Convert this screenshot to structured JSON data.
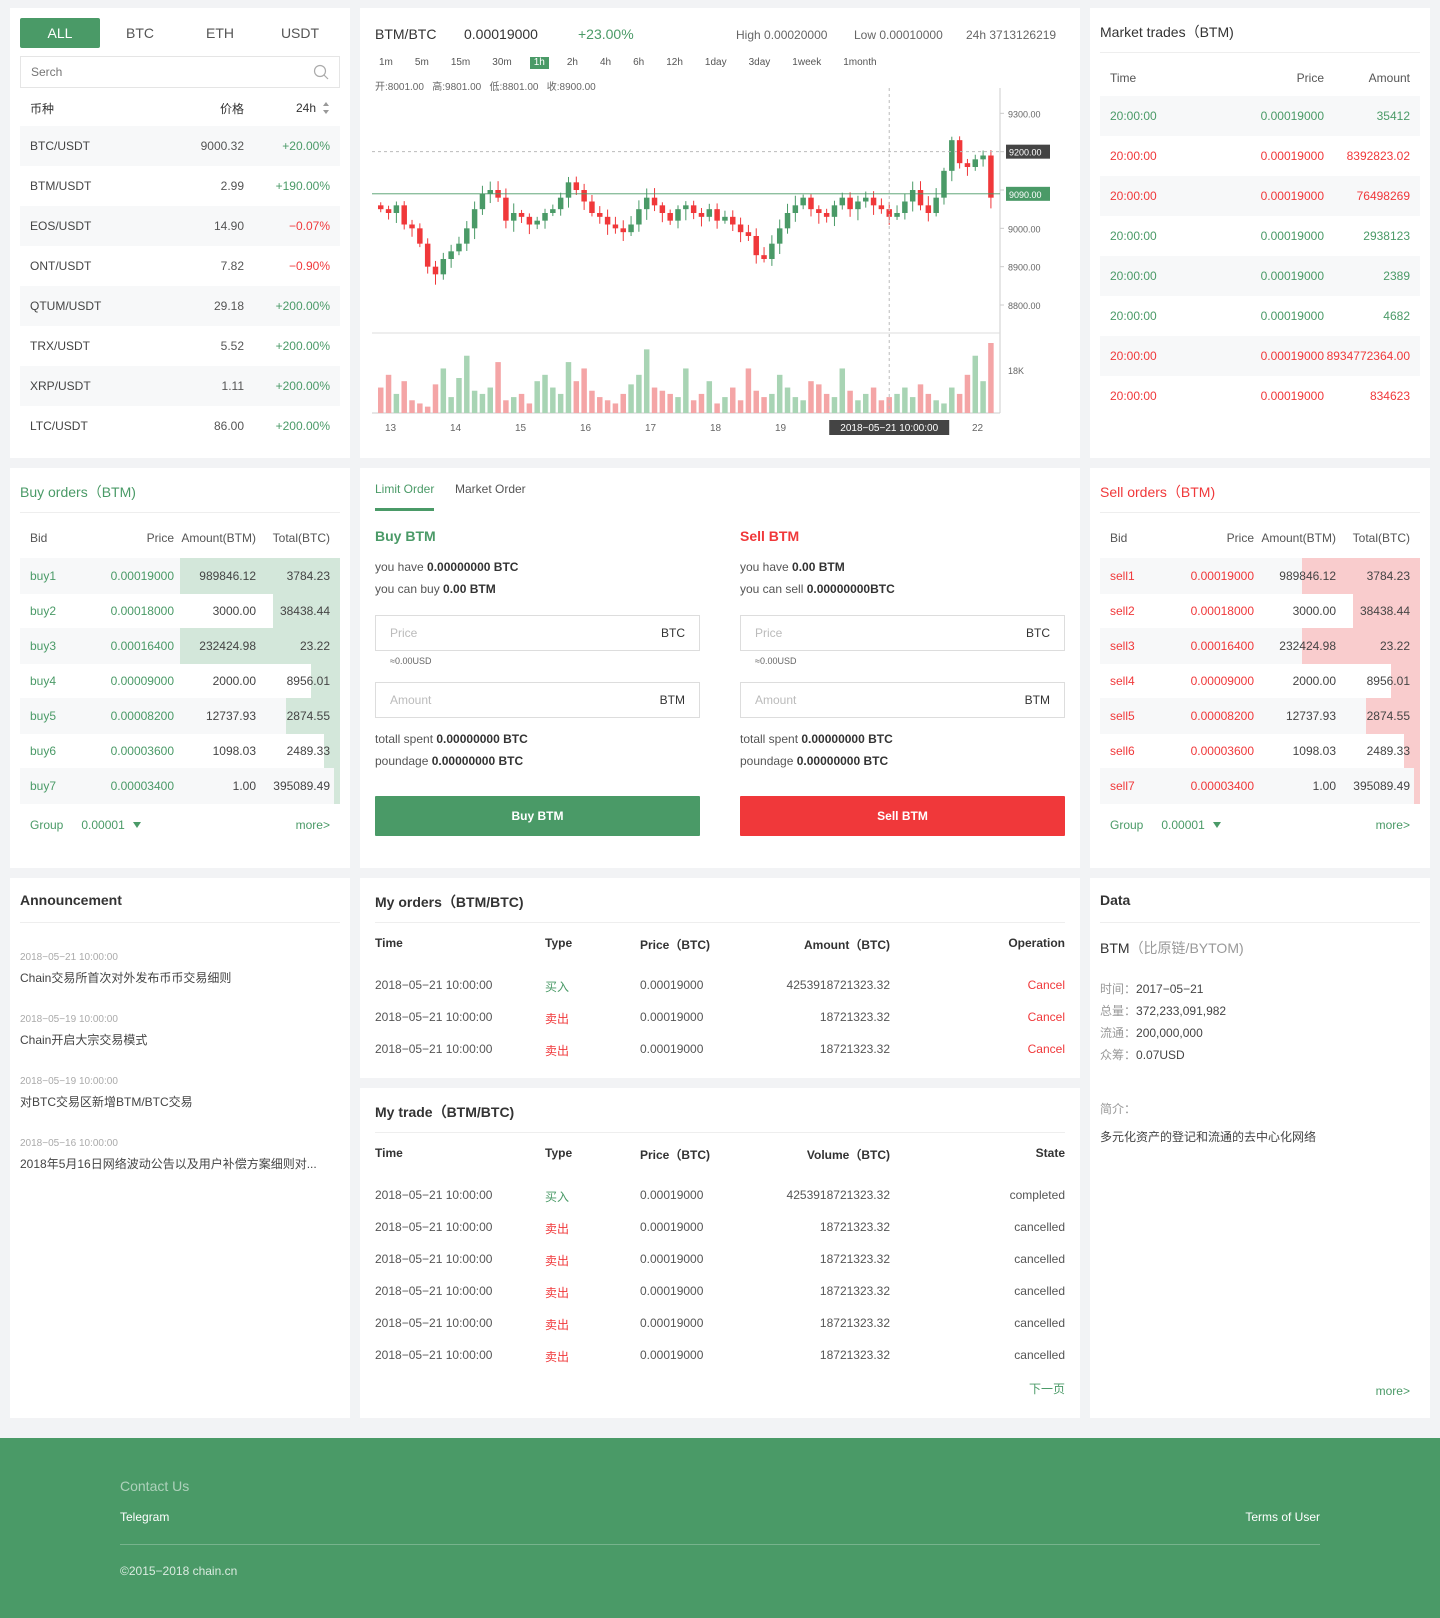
{
  "market": {
    "tabs": [
      "ALL",
      "BTC",
      "ETH",
      "USDT"
    ],
    "search_placeholder": "Serch",
    "headers": {
      "coin": "币种",
      "price": "价格",
      "change": "24h"
    },
    "rows": [
      {
        "pair": "BTC/USDT",
        "price": "9000.32",
        "change": "+20.00%",
        "dir": "up"
      },
      {
        "pair": "BTM/USDT",
        "price": "2.99",
        "change": "+190.00%",
        "dir": "up"
      },
      {
        "pair": "EOS/USDT",
        "price": "14.90",
        "change": "−0.07%",
        "dir": "down"
      },
      {
        "pair": "ONT/USDT",
        "price": "7.82",
        "change": "−0.90%",
        "dir": "down"
      },
      {
        "pair": "QTUM/USDT",
        "price": "29.18",
        "change": "+200.00%",
        "dir": "up"
      },
      {
        "pair": "TRX/USDT",
        "price": "5.52",
        "change": "+200.00%",
        "dir": "up"
      },
      {
        "pair": "XRP/USDT",
        "price": "1.11",
        "change": "+200.00%",
        "dir": "up"
      },
      {
        "pair": "LTC/USDT",
        "price": "86.00",
        "change": "+200.00%",
        "dir": "up"
      }
    ]
  },
  "chart": {
    "pair": "BTM/BTC",
    "price": "0.00019000",
    "change": "+23.00%",
    "high": "High 0.00020000",
    "low": "Low 0.00010000",
    "vol24": "24h 3713126219",
    "timeframes": [
      "1m",
      "5m",
      "15m",
      "30m",
      "1h",
      "2h",
      "4h",
      "6h",
      "12h",
      "1day",
      "3day",
      "1week",
      "1month"
    ],
    "active_tf": "1h",
    "ohlc": "开:8001.00   高:9801.00   低:8801.00   收:8900.00",
    "y_ticks": [
      "9300.00",
      "9200.00",
      "9100.00",
      "9000.00",
      "8900.00",
      "8800.00"
    ],
    "vol_tick": "18K",
    "x_ticks": [
      "13",
      "14",
      "15",
      "16",
      "17",
      "18",
      "19",
      "22"
    ],
    "cursor_time": "2018−05−21 10:00:00",
    "tag_a": "9200.00",
    "tag_b": "9090.00"
  },
  "chart_data": {
    "type": "candlestick",
    "x_ticks": [
      "13",
      "14",
      "15",
      "16",
      "17",
      "18",
      "19",
      "22"
    ],
    "ylim": [
      8740,
      9340
    ],
    "closes": [
      9050,
      9040,
      9060,
      9010,
      9000,
      8960,
      8900,
      8880,
      8920,
      8940,
      8960,
      9000,
      9050,
      9090,
      9100,
      9080,
      9020,
      9040,
      9030,
      9010,
      9020,
      9040,
      9050,
      9080,
      9120,
      9100,
      9070,
      9040,
      9030,
      9010,
      9000,
      8990,
      9010,
      9050,
      9080,
      9060,
      9040,
      9020,
      9050,
      9060,
      9040,
      9030,
      9050,
      9020,
      9030,
      9010,
      8990,
      8980,
      8930,
      8920,
      8960,
      9000,
      9040,
      9060,
      9080,
      9050,
      9040,
      9030,
      9060,
      9080,
      9050,
      9070,
      9080,
      9060,
      9050,
      9030,
      9040,
      9070,
      9100,
      9060,
      9040,
      9080,
      9150,
      9230,
      9170,
      9160,
      9180,
      9190,
      9080
    ],
    "volumes": [
      8,
      12,
      6,
      10,
      4,
      3,
      2,
      9,
      14,
      5,
      11,
      18,
      7,
      6,
      8,
      16,
      4,
      5,
      6,
      3,
      10,
      12,
      8,
      6,
      16,
      10,
      14,
      7,
      5,
      4,
      3,
      6,
      9,
      12,
      20,
      8,
      7,
      6,
      5,
      14,
      4,
      6,
      10,
      3,
      5,
      8,
      4,
      14,
      7,
      5,
      6,
      12,
      8,
      5,
      4,
      10,
      9,
      6,
      5,
      14,
      7,
      4,
      6,
      8,
      4,
      5,
      6,
      8,
      5,
      9,
      6,
      4,
      3,
      8,
      6,
      12,
      18,
      10,
      22
    ]
  },
  "trades": {
    "title": "Market trades（BTM)",
    "headers": {
      "time": "Time",
      "price": "Price",
      "amount": "Amount"
    },
    "rows": [
      {
        "time": "20:00:00",
        "price": "0.00019000",
        "amount": "35412",
        "dir": "up"
      },
      {
        "time": "20:00:00",
        "price": "0.00019000",
        "amount": "8392823.02",
        "dir": "down"
      },
      {
        "time": "20:00:00",
        "price": "0.00019000",
        "amount": "76498269",
        "dir": "down"
      },
      {
        "time": "20:00:00",
        "price": "0.00019000",
        "amount": "2938123",
        "dir": "up"
      },
      {
        "time": "20:00:00",
        "price": "0.00019000",
        "amount": "2389",
        "dir": "up"
      },
      {
        "time": "20:00:00",
        "price": "0.00019000",
        "amount": "4682",
        "dir": "up"
      },
      {
        "time": "20:00:00",
        "price": "0.00019000",
        "amount": "8934772364.00",
        "dir": "down"
      },
      {
        "time": "20:00:00",
        "price": "0.00019000",
        "amount": "834623",
        "dir": "down"
      }
    ]
  },
  "buy_orders": {
    "title": "Buy orders（BTM)",
    "headers": {
      "bid": "Bid",
      "price": "Price",
      "amount": "Amount(BTM)",
      "total": "Total(BTC)"
    },
    "rows": [
      {
        "bid": "buy1",
        "price": "0.00019000",
        "amount": "989846.12",
        "total": "3784.23",
        "depth": 0.5
      },
      {
        "bid": "buy2",
        "price": "0.00018000",
        "amount": "3000.00",
        "total": "38438.44",
        "depth": 0.21
      },
      {
        "bid": "buy3",
        "price": "0.00016400",
        "amount": "232424.98",
        "total": "23.22",
        "depth": 0.5
      },
      {
        "bid": "buy4",
        "price": "0.00009000",
        "amount": "2000.00",
        "total": "8956.01",
        "depth": 0.09
      },
      {
        "bid": "buy5",
        "price": "0.00008200",
        "amount": "12737.93",
        "total": "2874.55",
        "depth": 0.17
      },
      {
        "bid": "buy6",
        "price": "0.00003600",
        "amount": "1098.03",
        "total": "2489.33",
        "depth": 0.05
      },
      {
        "bid": "buy7",
        "price": "0.00003400",
        "amount": "1.00",
        "total": "395089.49",
        "depth": 0.02
      }
    ],
    "group_label": "Group",
    "group_value": "0.00001",
    "more": "more>"
  },
  "sell_orders": {
    "title": "Sell orders（BTM)",
    "headers": {
      "bid": "Bid",
      "price": "Price",
      "amount": "Amount(BTM)",
      "total": "Total(BTC)"
    },
    "rows": [
      {
        "bid": "sell1",
        "price": "0.00019000",
        "amount": "989846.12",
        "total": "3784.23",
        "depth": 0.37
      },
      {
        "bid": "sell2",
        "price": "0.00018000",
        "amount": "3000.00",
        "total": "38438.44",
        "depth": 0.21
      },
      {
        "bid": "sell3",
        "price": "0.00016400",
        "amount": "232424.98",
        "total": "23.22",
        "depth": 0.37
      },
      {
        "bid": "sell4",
        "price": "0.00009000",
        "amount": "2000.00",
        "total": "8956.01",
        "depth": 0.09
      },
      {
        "bid": "sell5",
        "price": "0.00008200",
        "amount": "12737.93",
        "total": "2874.55",
        "depth": 0.17
      },
      {
        "bid": "sell6",
        "price": "0.00003600",
        "amount": "1098.03",
        "total": "2489.33",
        "depth": 0.05
      },
      {
        "bid": "sell7",
        "price": "0.00003400",
        "amount": "1.00",
        "total": "395089.49",
        "depth": 0.02
      }
    ],
    "group_label": "Group",
    "group_value": "0.00001",
    "more": "more>"
  },
  "order_form": {
    "tabs": [
      "Limit Order",
      "Market Order"
    ],
    "buy": {
      "title": "Buy BTM",
      "have_label": "you have ",
      "have_value": "0.00000000 BTC",
      "can_label": "you can buy ",
      "can_value": "0.00 BTM",
      "price_ph": "Price",
      "price_unit": "BTC",
      "usd": "≈0.00USD",
      "amount_ph": "Amount",
      "amount_unit": "BTM",
      "spent_label": "totall spent ",
      "spent_value": "0.00000000 BTC",
      "fee_label": "poundage ",
      "fee_value": "0.00000000 BTC",
      "button": "Buy BTM"
    },
    "sell": {
      "title": "Sell BTM",
      "have_label": "you have ",
      "have_value": "0.00 BTM",
      "can_label": "you can sell ",
      "can_value": "0.00000000BTC",
      "price_ph": "Price",
      "price_unit": "BTC",
      "usd": "≈0.00USD",
      "amount_ph": "Amount",
      "amount_unit": "BTM",
      "spent_label": "totall spent ",
      "spent_value": "0.00000000 BTC",
      "fee_label": "poundage ",
      "fee_value": "0.00000000 BTC",
      "button": "Sell BTM"
    }
  },
  "announcement": {
    "title": "Announcement",
    "items": [
      {
        "date": "2018−05−21 10:00:00",
        "text": "Chain交易所首次对外发布币币交易细则"
      },
      {
        "date": "2018−05−19 10:00:00",
        "text": "Chain开启大宗交易模式"
      },
      {
        "date": "2018−05−19 10:00:00",
        "text": "对BTC交易区新增BTM/BTC交易"
      },
      {
        "date": "2018−05−16 10:00:00",
        "text": "2018年5月16日网络波动公告以及用户补偿方案细则对..."
      }
    ]
  },
  "my_orders": {
    "title": "My orders（BTM/BTC)",
    "headers": [
      "Time",
      "Type",
      "Price（BTC)",
      "Amount（BTC)",
      "Operation"
    ],
    "rows": [
      {
        "time": "2018−05−21 10:00:00",
        "type": "买入",
        "dir": "up",
        "price": "0.00019000",
        "amount": "4253918721323.32",
        "op": "Cancel"
      },
      {
        "time": "2018−05−21 10:00:00",
        "type": "卖出",
        "dir": "down",
        "price": "0.00019000",
        "amount": "18721323.32",
        "op": "Cancel"
      },
      {
        "time": "2018−05−21 10:00:00",
        "type": "卖出",
        "dir": "down",
        "price": "0.00019000",
        "amount": "18721323.32",
        "op": "Cancel"
      }
    ]
  },
  "my_trade": {
    "title": "My trade（BTM/BTC)",
    "headers": [
      "Time",
      "Type",
      "Price（BTC)",
      "Volume（BTC)",
      "State"
    ],
    "rows": [
      {
        "time": "2018−05−21 10:00:00",
        "type": "买入",
        "dir": "up",
        "price": "0.00019000",
        "amount": "4253918721323.32",
        "state": "completed"
      },
      {
        "time": "2018−05−21 10:00:00",
        "type": "卖出",
        "dir": "down",
        "price": "0.00019000",
        "amount": "18721323.32",
        "state": "cancelled"
      },
      {
        "time": "2018−05−21 10:00:00",
        "type": "卖出",
        "dir": "down",
        "price": "0.00019000",
        "amount": "18721323.32",
        "state": "cancelled"
      },
      {
        "time": "2018−05−21 10:00:00",
        "type": "卖出",
        "dir": "down",
        "price": "0.00019000",
        "amount": "18721323.32",
        "state": "cancelled"
      },
      {
        "time": "2018−05−21 10:00:00",
        "type": "卖出",
        "dir": "down",
        "price": "0.00019000",
        "amount": "18721323.32",
        "state": "cancelled"
      },
      {
        "time": "2018−05−21 10:00:00",
        "type": "卖出",
        "dir": "down",
        "price": "0.00019000",
        "amount": "18721323.32",
        "state": "cancelled"
      }
    ],
    "next": "下一页"
  },
  "coin_data": {
    "title": "Data",
    "name": "BTM",
    "name_sub": "（比原链/BYTOM)",
    "fields": [
      {
        "label": "时间：",
        "value": "2017−05−21"
      },
      {
        "label": "总量：",
        "value": "372,233,091,982"
      },
      {
        "label": "流通：",
        "value": "200,000,000"
      },
      {
        "label": "众筹：",
        "value": "0.07USD"
      }
    ],
    "intro_label": "简介：",
    "intro": "多元化资产的登记和流通的去中心化网络",
    "more": "more>"
  },
  "footer": {
    "contact": "Contact Us",
    "telegram": "Telegram",
    "terms": "Terms of User",
    "copyright": "©2015−2018  chain.cn"
  },
  "colors": {
    "green": "#4a9a67",
    "red": "#f0383a",
    "bg": "#f2f3f5"
  }
}
